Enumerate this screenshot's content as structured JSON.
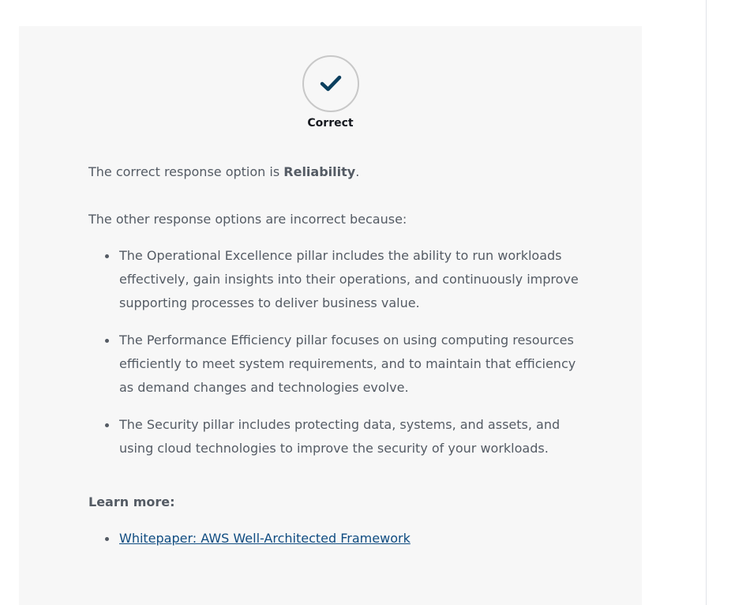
{
  "result": {
    "icon": "checkmark-icon",
    "label": "Correct",
    "accent_color": "#0b3f5e"
  },
  "answer": {
    "prefix": "The correct response option is ",
    "value": "Reliability",
    "suffix": "."
  },
  "explanation": {
    "intro": "The other response options are incorrect because:",
    "items": [
      "The Operational Excellence pillar includes the ability to run workloads effectively, gain insights into their operations, and continuously improve supporting processes to deliver business value.",
      "The Performance Efficiency pillar focuses on using computing resources efficiently to meet system requirements, and to maintain that efficiency as demand changes and technologies evolve.",
      "The Security pillar includes protecting data, systems, and assets, and using cloud technologies to improve the security of your workloads."
    ]
  },
  "learn_more": {
    "title": "Learn more:",
    "links": [
      "Whitepaper: AWS Well-Architected Framework"
    ]
  }
}
